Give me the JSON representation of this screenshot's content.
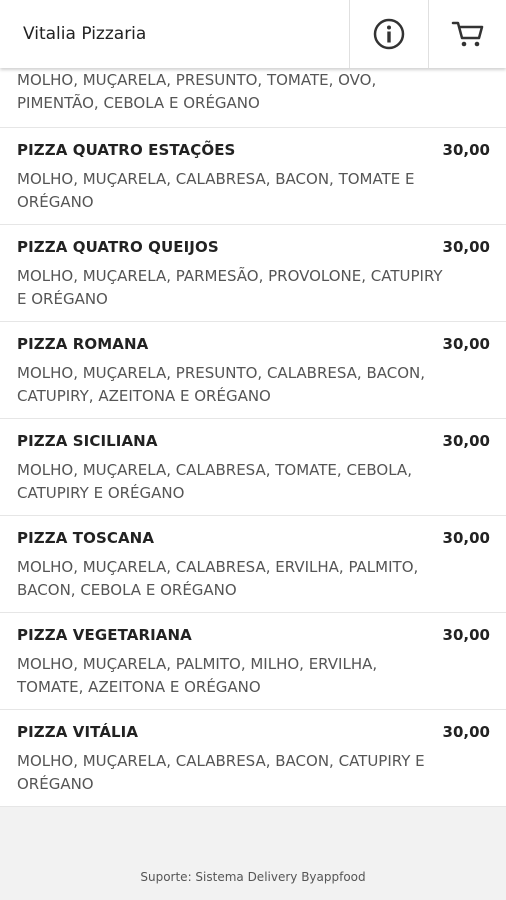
{
  "header": {
    "title": "Vitalia Pizzaria",
    "info_icon": "info-icon",
    "cart_icon": "cart-icon"
  },
  "partial_item": {
    "description": "MOLHO, MUÇARELA, PRESUNTO, TOMATE, OVO, PIMENTÃO, CEBOLA E ORÉGANO"
  },
  "items": [
    {
      "name": "PIZZA QUATRO ESTAÇÕES",
      "price": "30,00",
      "description": "MOLHO, MUÇARELA, CALABRESA, BACON, TOMATE E ORÉGANO"
    },
    {
      "name": "PIZZA QUATRO QUEIJOS",
      "price": "30,00",
      "description": "MOLHO, MUÇARELA, PARMESÃO, PROVOLONE, CATUPIRY E ORÉGANO"
    },
    {
      "name": "PIZZA ROMANA",
      "price": "30,00",
      "description": "MOLHO, MUÇARELA, PRESUNTO, CALABRESA, BACON, CATUPIRY, AZEITONA E ORÉGANO"
    },
    {
      "name": "PIZZA SICILIANA",
      "price": "30,00",
      "description": "MOLHO, MUÇARELA, CALABRESA, TOMATE, CEBOLA, CATUPIRY E ORÉGANO"
    },
    {
      "name": "PIZZA TOSCANA",
      "price": "30,00",
      "description": "MOLHO, MUÇARELA, CALABRESA, ERVILHA, PALMITO, BACON, CEBOLA E ORÉGANO"
    },
    {
      "name": "PIZZA VEGETARIANA",
      "price": "30,00",
      "description": "MOLHO, MUÇARELA, PALMITO, MILHO, ERVILHA, TOMATE, AZEITONA E ORÉGANO"
    },
    {
      "name": "PIZZA VITÁLIA",
      "price": "30,00",
      "description": "MOLHO, MUÇARELA, CALABRESA, BACON, CATUPIRY E ORÉGANO"
    }
  ],
  "footer": {
    "text": "Suporte: Sistema Delivery Byappfood"
  }
}
